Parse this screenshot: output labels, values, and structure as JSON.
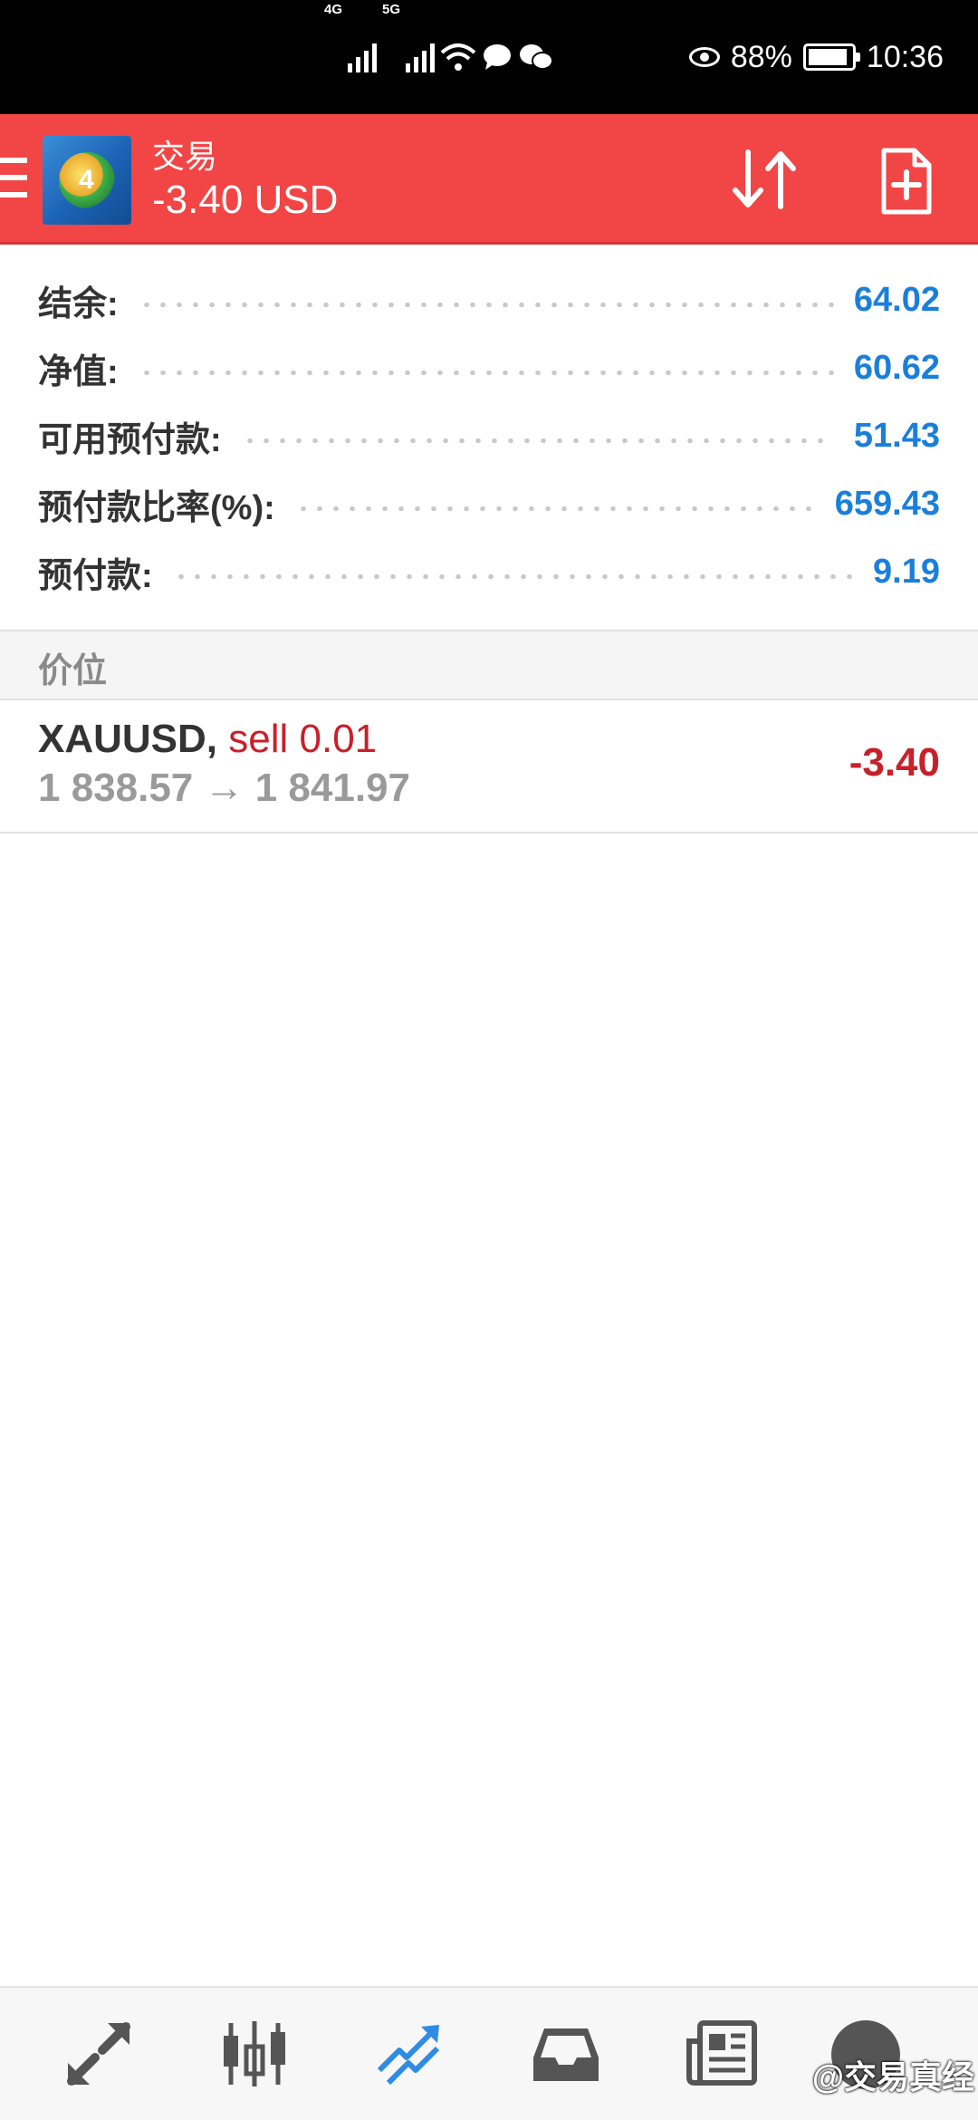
{
  "status_bar": {
    "net1": "4G",
    "net2": "5G",
    "battery_pct": "88%",
    "time": "10:36"
  },
  "app_bar": {
    "title": "交易",
    "subtitle": "-3.40 USD",
    "logo_digit": "4"
  },
  "summary": [
    {
      "label": "结余:",
      "value": "64.02"
    },
    {
      "label": "净值:",
      "value": "60.62"
    },
    {
      "label": "可用预付款:",
      "value": "51.43"
    },
    {
      "label": "预付款比率(%):",
      "value": "659.43"
    },
    {
      "label": "预付款:",
      "value": "9.19"
    }
  ],
  "positions_header": "价位",
  "position": {
    "symbol": "XAUUSD,",
    "side": "sell 0.01",
    "prices": "1 838.57 → 1 841.97",
    "profit": "-3.40"
  },
  "watermark": "@交易真经",
  "colors": {
    "accent_bar": "#f24545",
    "value_blue": "#1a7fdb",
    "loss_red": "#c8202a",
    "nav_active": "#2f8be3",
    "nav_inactive": "#555555"
  }
}
